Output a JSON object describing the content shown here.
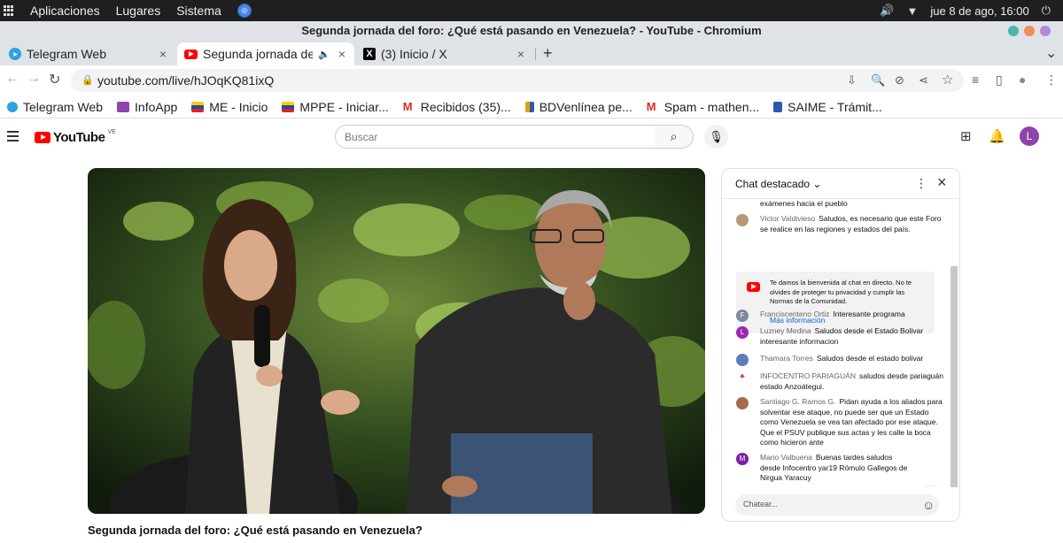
{
  "system": {
    "menu": [
      "Aplicaciones",
      "Lugares",
      "Sistema"
    ],
    "clock": "jue  8 de ago, 16:00",
    "tray": [
      "🔊",
      "▼",
      "⏻"
    ]
  },
  "window": {
    "title": "Segunda jornada del foro: ¿Qué está pasando en Venezuela? - YouTube - Chromium"
  },
  "tabs": [
    {
      "label": "Telegram Web"
    },
    {
      "label": "Segunda jornada del foro: ¿Qué está pasando en Venezuela?"
    },
    {
      "label": "(3) Inicio / X"
    }
  ],
  "icons": {
    "close": "×",
    "new_tab": "+",
    "tab_menu": "⌄",
    "back": "←",
    "forward": "→",
    "reload": "↻",
    "lock": "🔒",
    "install": "⇩",
    "zoom": "🔍",
    "eye_off": "⊘",
    "share": "⋖",
    "star": "☆",
    "queue": "≡",
    "sidepanel": "▯",
    "profile": "●",
    "kebab": "⋮",
    "search": "⌕",
    "mic": "🎙",
    "create": "⊞",
    "bell": "🔔",
    "caret": "⌄",
    "heart": "❤",
    "emoji": "☺",
    "speaker": "🔈"
  },
  "address": {
    "url": "youtube.com/live/hJOqKQ81ixQ"
  },
  "bookmarks": [
    {
      "label": "Telegram Web",
      "color": "#2aa3df"
    },
    {
      "label": "InfoApp",
      "color": "#8e44ad"
    },
    {
      "label": "ME - Inicio",
      "color": "#e8b04a"
    },
    {
      "label": "MPPE - Iniciar...",
      "color": "#e8b04a"
    },
    {
      "label": "Recibidos (35)...",
      "color": "#d93025"
    },
    {
      "label": "BDVenlínea pe...",
      "color": "#e0a010"
    },
    {
      "label": "Spam - mathen...",
      "color": "#d93025"
    },
    {
      "label": "SAIME - Trámit...",
      "color": "#2b5aa8"
    }
  ],
  "youtube": {
    "logo": "YouTube",
    "country": "VE",
    "search_placeholder": "Buscar",
    "avatar_letter": "L",
    "video_title": "Segunda jornada del foro: ¿Qué está pasando en Venezuela?"
  },
  "chat": {
    "header": "Chat destacado",
    "welcome": "Te damos la bienvenida al chat en directo. No te olvides de proteger tu privacidad y cumplir las Normas de la Comunidad.",
    "more_info": "Más información",
    "input_placeholder": "Chatear...",
    "top_fragment": "exámenes hacia el pueblo",
    "messages": [
      {
        "author": "Victor Valdivieso",
        "text": "Saludos, es necesario que este Foro se realice en las regiones y estados del país.",
        "initial": "",
        "color": "#b59a7a"
      },
      {
        "author": "Franciscenteno Ortiz",
        "text": "Interesante programa",
        "initial": "F",
        "color": "#7d8a9a"
      },
      {
        "author": "Luzney Medina",
        "text": "Saludos desde el Estado Bolivar interesante informacion",
        "initial": "L",
        "color": "#9c27b0"
      },
      {
        "author": "Thamara Torres",
        "text": "Saludos desde el estado bolivar",
        "initial": "",
        "color": "#5a7fb8"
      },
      {
        "author": "INFOCENTRO PARIAGUÁN",
        "text": "saludos desde pariaguán estado Anzoátegui.",
        "initial": "",
        "color": "#c23b3b"
      },
      {
        "author": "Santiago G. Ramos G.",
        "text": "Pidan ayuda a los aliados para solventar ese ataque, no puede ser que un Estado como Venezuela se vea tan afectado por ese ataque. Que el PSUV publique sus actas y les calle la boca como hicieron ante",
        "initial": "",
        "color": "#a86a4a"
      },
      {
        "author": "Mario Valbuena",
        "text": "Buenas tardes saludos desde Infocentro yar19 Rómulo Gallegos de Nirgua Yaracuy",
        "initial": "M",
        "color": "#7b1fa2"
      }
    ]
  }
}
